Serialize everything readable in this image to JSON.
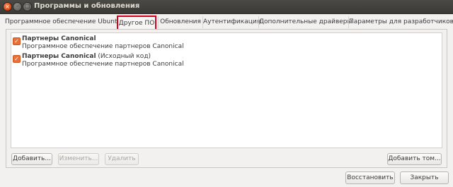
{
  "window": {
    "title": "Программы и обновления",
    "close_glyph": "×",
    "min_glyph": "–",
    "max_glyph": "□"
  },
  "tabs": [
    {
      "label": "Программное обеспечение Ubuntu"
    },
    {
      "label": "Другое ПО",
      "active": true
    },
    {
      "label": "Обновления"
    },
    {
      "label": "Аутентификация"
    },
    {
      "label": "Дополнительные драйверы"
    },
    {
      "label": "Параметры для разработчиков"
    }
  ],
  "sources": [
    {
      "title": "Партнеры Canonical",
      "title_suffix": "",
      "subtitle": "Программное обеспечение партнеров Canonical",
      "checked": true
    },
    {
      "title": "Партнеры Canonical",
      "title_suffix": " (Исходный код)",
      "subtitle": "Программное обеспечение партнеров Canonical",
      "checked": true
    }
  ],
  "list_buttons": {
    "add": "Добавить...",
    "edit": "Изменить...",
    "remove": "Удалить",
    "add_volume": "Добавить том..."
  },
  "footer": {
    "revert": "Восстановить",
    "close": "Закрыть"
  },
  "colors": {
    "highlight": "#d9001b",
    "checkbox": "#e9703a",
    "titlebar": "#3b3a36"
  }
}
